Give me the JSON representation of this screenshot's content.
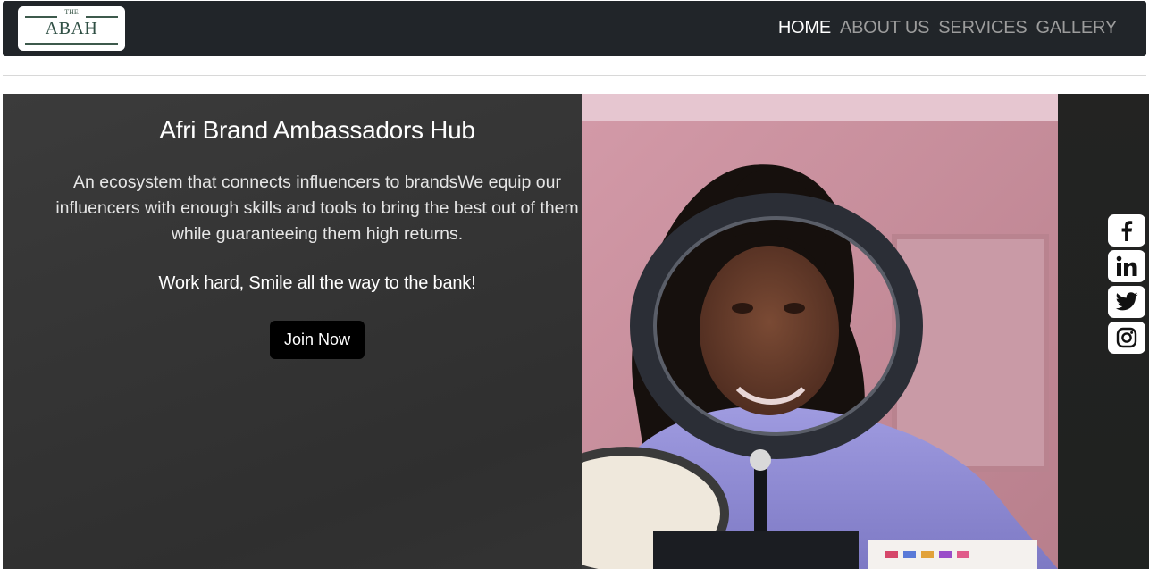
{
  "logo": {
    "small_text": "THE",
    "name": "ABAH"
  },
  "nav": {
    "items": [
      {
        "label": "HOME",
        "active": true
      },
      {
        "label": "ABOUT US",
        "active": false
      },
      {
        "label": "SERVICES",
        "active": false
      },
      {
        "label": "GALLERY",
        "active": false
      }
    ]
  },
  "hero": {
    "title": "Afri Brand Ambassadors Hub",
    "description": "An ecosystem that connects influencers to brandsWe equip our influencers with enough skills and tools to bring the best out of them while guaranteeing them high returns.",
    "tagline": "Work hard, Smile all the way to the bank!",
    "cta_label": "Join Now"
  },
  "social": {
    "icons": [
      "facebook-icon",
      "linkedin-icon",
      "twitter-icon",
      "instagram-icon"
    ]
  },
  "colors": {
    "navbar_bg": "#212529",
    "hero_bg": "#333333",
    "button_bg": "#000000",
    "nav_active": "#ffffff",
    "nav_inactive": "#9c9c9c"
  }
}
